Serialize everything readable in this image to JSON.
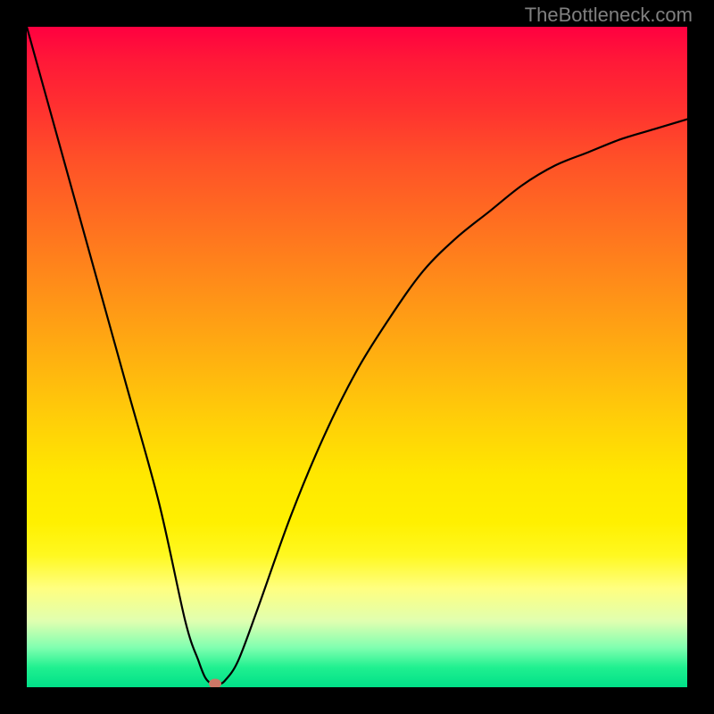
{
  "watermark": "TheBottleneck.com",
  "chart_data": {
    "type": "line",
    "title": "",
    "xlabel": "",
    "ylabel": "",
    "xlim": [
      0,
      100
    ],
    "ylim": [
      0,
      100
    ],
    "series": [
      {
        "name": "bottleneck-curve",
        "x": [
          0,
          5,
          10,
          15,
          20,
          24,
          26,
          27,
          28,
          29,
          30,
          32,
          35,
          40,
          45,
          50,
          55,
          60,
          65,
          70,
          75,
          80,
          85,
          90,
          95,
          100
        ],
        "values": [
          100,
          82,
          64,
          46,
          28,
          10,
          4,
          1.5,
          0.5,
          0.5,
          1.0,
          4,
          12,
          26,
          38,
          48,
          56,
          63,
          68,
          72,
          76,
          79,
          81,
          83,
          84.5,
          86
        ]
      }
    ],
    "marker": {
      "x": 28.5,
      "y": 0.5
    },
    "gradient_direction": "top-to-bottom",
    "gradient_meaning": "top=high bottleneck (red), bottom=low bottleneck (green)"
  }
}
